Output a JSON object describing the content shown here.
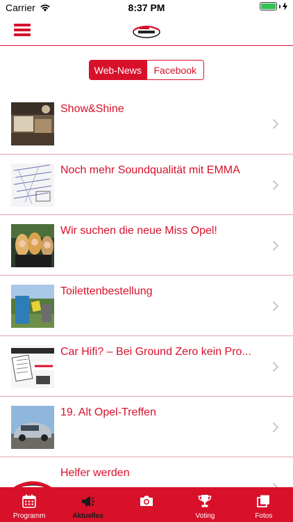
{
  "status_bar": {
    "carrier": "Carrier",
    "time": "8:37 PM"
  },
  "header": {
    "logo_icon": "oldtimer-treffen-logo"
  },
  "segmented": {
    "web_news": "Web-News",
    "facebook": "Facebook",
    "selected": "Web-News"
  },
  "news": [
    {
      "title": "Show&Shine",
      "thumb": "car-interior-photo"
    },
    {
      "title": "Noch mehr Soundqualität mit EMMA",
      "thumb": "document-scan-photo"
    },
    {
      "title": "Wir suchen die neue Miss Opel!",
      "thumb": "models-photo"
    },
    {
      "title": "Toilettenbestellung",
      "thumb": "toilet-photo"
    },
    {
      "title": "Car Hifi? – Bei Ground Zero kein Pro...",
      "thumb": "ground-zero-box-photo"
    },
    {
      "title": "19. Alt Opel-Treffen",
      "thumb": "classic-car-photo"
    },
    {
      "title": "Helfer werden",
      "thumb": "treffen-logo-photo"
    }
  ],
  "tabs": [
    {
      "label": "Programm",
      "icon": "calendar-icon",
      "active": false
    },
    {
      "label": "Aktuelles",
      "icon": "megaphone-icon",
      "active": true
    },
    {
      "label": "",
      "icon": "camera-icon",
      "active": false
    },
    {
      "label": "Voting",
      "icon": "trophy-icon",
      "active": false
    },
    {
      "label": "Fotos",
      "icon": "photos-icon",
      "active": false
    }
  ],
  "colors": {
    "accent": "#d8102a",
    "separator": "#e3a3aa",
    "active_tab_label": "#1a1a1a"
  }
}
